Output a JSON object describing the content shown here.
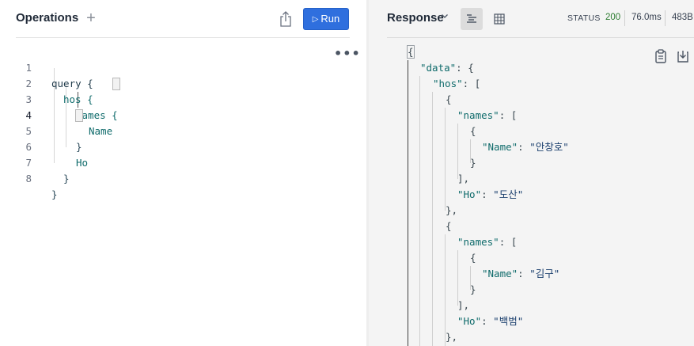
{
  "operations": {
    "title": "Operations",
    "add_icon": "plus-icon",
    "share_icon": "share-icon",
    "run_label": "Run",
    "more_icon": "more-dots-icon",
    "more_glyph": "•••"
  },
  "editor": {
    "active_line": 4,
    "lines": [
      {
        "num": "1",
        "text": "query {"
      },
      {
        "num": "2",
        "text": "hos {"
      },
      {
        "num": "3",
        "text": "names {"
      },
      {
        "num": "4",
        "text": "Name"
      },
      {
        "num": "5",
        "text": "}"
      },
      {
        "num": "6",
        "text": "Ho"
      },
      {
        "num": "7",
        "text": "}"
      },
      {
        "num": "8",
        "text": "}"
      }
    ]
  },
  "response": {
    "title": "Response",
    "status_label": "STATUS",
    "status_code": "200",
    "time": "76.0ms",
    "size": "483B",
    "view_json_icon": "json-view-icon",
    "view_table_icon": "table-view-icon",
    "copy_icon": "clipboard-icon",
    "download_icon": "download-icon",
    "lines": [
      {
        "text": "{"
      },
      {
        "key": "\"data\"",
        "rest": ": {"
      },
      {
        "key": "\"hos\"",
        "rest": ": ["
      },
      {
        "text": "{"
      },
      {
        "key": "\"names\"",
        "rest": ": ["
      },
      {
        "text": "{"
      },
      {
        "key": "\"Name\"",
        "rest": ": ",
        "value": "\"안창호\""
      },
      {
        "text": "}"
      },
      {
        "text": "],"
      },
      {
        "key": "\"Ho\"",
        "rest": ": ",
        "value": "\"도산\""
      },
      {
        "text": "},"
      },
      {
        "text": "{"
      },
      {
        "key": "\"names\"",
        "rest": ": ["
      },
      {
        "text": "{"
      },
      {
        "key": "\"Name\"",
        "rest": ": ",
        "value": "\"김구\""
      },
      {
        "text": "}"
      },
      {
        "text": "],"
      },
      {
        "key": "\"Ho\"",
        "rest": ": ",
        "value": "\"백범\""
      },
      {
        "text": "},"
      }
    ]
  },
  "colors": {
    "run_button": "#2f6fde",
    "status_ok": "#2e7d32",
    "field": "#0f6b6b",
    "string": "#1b3f6e"
  }
}
